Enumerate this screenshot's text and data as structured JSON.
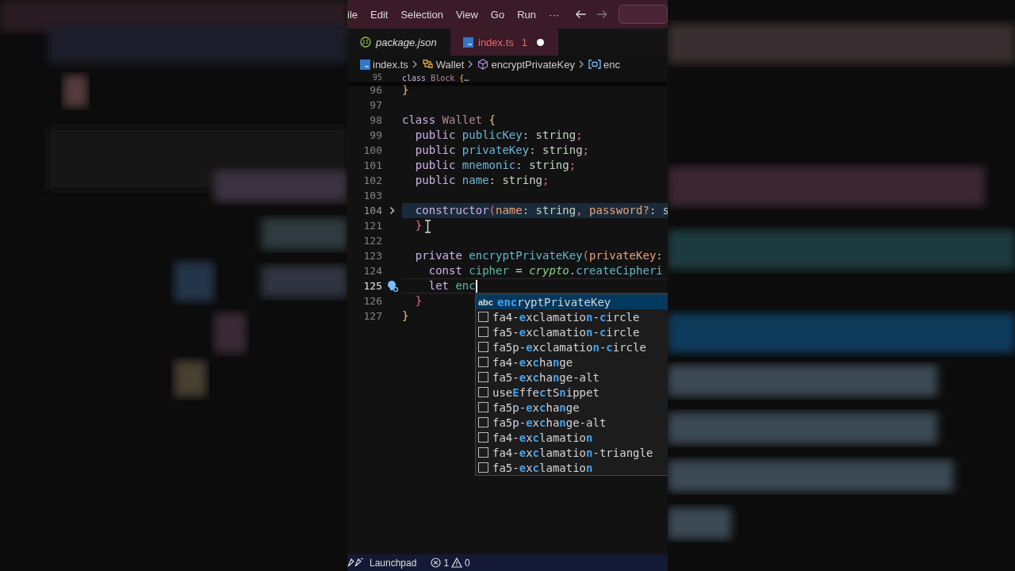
{
  "menu": [
    "ile",
    "Edit",
    "Selection",
    "View",
    "Go",
    "Run",
    "···"
  ],
  "tabs": [
    {
      "label": "package.json",
      "kind": "json",
      "selected": false,
      "italic": true
    },
    {
      "label": "index.ts",
      "kind": "ts",
      "selected": true,
      "italic": false,
      "problems": "1",
      "modified": true
    }
  ],
  "breadcrumb": [
    {
      "label": "index.ts",
      "kind": "file"
    },
    {
      "label": "Wallet",
      "kind": "class"
    },
    {
      "label": "encryptPrivateKey",
      "kind": "method"
    },
    {
      "label": "enc",
      "kind": "variable"
    }
  ],
  "sticky_line": {
    "number": "95",
    "tokens": [
      {
        "text": "class ",
        "kind": "kw"
      },
      {
        "text": "Block ",
        "kind": "cls"
      },
      {
        "text": "{",
        "kind": "brace"
      },
      {
        "text": "…",
        "kind": "plain"
      }
    ]
  },
  "code_lines": [
    {
      "number": "96",
      "folded": false,
      "current": false,
      "tokens": [
        {
          "text": "}",
          "kind": "brace"
        }
      ]
    },
    {
      "number": "97",
      "folded": false,
      "current": false
    },
    {
      "number": "98",
      "folded": false,
      "current": false,
      "tokens": [
        {
          "text": "class ",
          "kind": "kw"
        },
        {
          "text": "Wallet ",
          "kind": "cls"
        },
        {
          "text": "{",
          "kind": "brace"
        }
      ]
    },
    {
      "number": "99",
      "folded": false,
      "current": false,
      "tokens": [
        {
          "text": "  public ",
          "kind": "kw"
        },
        {
          "text": "publicKey",
          "kind": "prop"
        },
        {
          "text": ": ",
          "kind": "plain"
        },
        {
          "text": "string",
          "kind": "type"
        },
        {
          "text": ";",
          "kind": "punct"
        }
      ]
    },
    {
      "number": "100",
      "folded": false,
      "current": false,
      "tokens": [
        {
          "text": "  public ",
          "kind": "kw"
        },
        {
          "text": "privateKey",
          "kind": "prop"
        },
        {
          "text": ": ",
          "kind": "plain"
        },
        {
          "text": "string",
          "kind": "type"
        },
        {
          "text": ";",
          "kind": "punct"
        }
      ]
    },
    {
      "number": "101",
      "folded": false,
      "current": false,
      "tokens": [
        {
          "text": "  public ",
          "kind": "kw"
        },
        {
          "text": "mnemonic",
          "kind": "prop"
        },
        {
          "text": ": ",
          "kind": "plain"
        },
        {
          "text": "string",
          "kind": "type"
        },
        {
          "text": ";",
          "kind": "punct"
        }
      ]
    },
    {
      "number": "102",
      "folded": false,
      "current": false,
      "tokens": [
        {
          "text": "  public ",
          "kind": "kw"
        },
        {
          "text": "name",
          "kind": "prop"
        },
        {
          "text": ": ",
          "kind": "plain"
        },
        {
          "text": "string",
          "kind": "type"
        },
        {
          "text": ";",
          "kind": "punct"
        }
      ]
    },
    {
      "number": "103",
      "folded": false,
      "current": false
    },
    {
      "number": "104",
      "folded": true,
      "current": false,
      "tokens": [
        {
          "text": "  constructor",
          "kind": "kw"
        },
        {
          "text": "(",
          "kind": "punct"
        },
        {
          "text": "name",
          "kind": "param"
        },
        {
          "text": ": ",
          "kind": "plain"
        },
        {
          "text": "string",
          "kind": "type"
        },
        {
          "text": ", ",
          "kind": "punct"
        },
        {
          "text": "password?",
          "kind": "param"
        },
        {
          "text": ": ",
          "kind": "plain"
        },
        {
          "text": "s",
          "kind": "type"
        }
      ]
    },
    {
      "number": "121",
      "folded": false,
      "current": false,
      "tokens": [
        {
          "text": "  }",
          "kind": "punct"
        }
      ]
    },
    {
      "number": "122",
      "folded": false,
      "current": false
    },
    {
      "number": "123",
      "folded": false,
      "current": false,
      "tokens": [
        {
          "text": "  private ",
          "kind": "kw"
        },
        {
          "text": "encryptPrivateKey",
          "kind": "fn"
        },
        {
          "text": "(",
          "kind": "punct"
        },
        {
          "text": "privateKey",
          "kind": "param"
        },
        {
          "text": ":",
          "kind": "plain"
        }
      ]
    },
    {
      "number": "124",
      "folded": false,
      "current": false,
      "tokens": [
        {
          "text": "    const ",
          "kind": "kw"
        },
        {
          "text": "cipher",
          "kind": "var"
        },
        {
          "text": " = ",
          "kind": "plain"
        },
        {
          "text": "crypto",
          "kind": "obj"
        },
        {
          "text": ".",
          "kind": "plain"
        },
        {
          "text": "createCipheri",
          "kind": "fn"
        }
      ]
    },
    {
      "number": "125",
      "folded": false,
      "current": true,
      "tokens": [
        {
          "text": "    let ",
          "kind": "kw"
        },
        {
          "text": "enc",
          "kind": "var"
        }
      ]
    },
    {
      "number": "126",
      "folded": false,
      "current": false,
      "tokens": [
        {
          "text": "  }",
          "kind": "punct"
        }
      ]
    },
    {
      "number": "127",
      "folded": false,
      "current": false,
      "tokens": [
        {
          "text": "}",
          "kind": "brace"
        }
      ]
    }
  ],
  "suggestions": [
    {
      "kind": "word",
      "icon_text": "abc",
      "selected": true,
      "parts": [
        {
          "text": "enc",
          "match": true
        },
        {
          "text": "ryptPrivateKey",
          "match": false
        }
      ]
    },
    {
      "kind": "snippet",
      "selected": false,
      "parts": [
        {
          "text": "fa4-",
          "match": false
        },
        {
          "text": "e",
          "match": true
        },
        {
          "text": "xclamatio",
          "match": false
        },
        {
          "text": "n",
          "match": true
        },
        {
          "text": "-",
          "match": false
        },
        {
          "text": "c",
          "match": true
        },
        {
          "text": "ircle",
          "match": false
        }
      ]
    },
    {
      "kind": "snippet",
      "selected": false,
      "parts": [
        {
          "text": "fa5-",
          "match": false
        },
        {
          "text": "e",
          "match": true
        },
        {
          "text": "xclamatio",
          "match": false
        },
        {
          "text": "n",
          "match": true
        },
        {
          "text": "-",
          "match": false
        },
        {
          "text": "c",
          "match": true
        },
        {
          "text": "ircle",
          "match": false
        }
      ]
    },
    {
      "kind": "snippet",
      "selected": false,
      "parts": [
        {
          "text": "fa5p-",
          "match": false
        },
        {
          "text": "e",
          "match": true
        },
        {
          "text": "xclamatio",
          "match": false
        },
        {
          "text": "n",
          "match": true
        },
        {
          "text": "-",
          "match": false
        },
        {
          "text": "c",
          "match": true
        },
        {
          "text": "ircle",
          "match": false
        }
      ]
    },
    {
      "kind": "snippet",
      "selected": false,
      "parts": [
        {
          "text": "fa4-",
          "match": false
        },
        {
          "text": "e",
          "match": true
        },
        {
          "text": "x",
          "match": false
        },
        {
          "text": "c",
          "match": true
        },
        {
          "text": "ha",
          "match": false
        },
        {
          "text": "n",
          "match": true
        },
        {
          "text": "ge",
          "match": false
        }
      ]
    },
    {
      "kind": "snippet",
      "selected": false,
      "parts": [
        {
          "text": "fa5-",
          "match": false
        },
        {
          "text": "e",
          "match": true
        },
        {
          "text": "x",
          "match": false
        },
        {
          "text": "c",
          "match": true
        },
        {
          "text": "ha",
          "match": false
        },
        {
          "text": "n",
          "match": true
        },
        {
          "text": "ge-alt",
          "match": false
        }
      ]
    },
    {
      "kind": "snippet",
      "selected": false,
      "parts": [
        {
          "text": "use",
          "match": false
        },
        {
          "text": "E",
          "match": true
        },
        {
          "text": "ffe",
          "match": false
        },
        {
          "text": "c",
          "match": true
        },
        {
          "text": "tS",
          "match": false
        },
        {
          "text": "n",
          "match": true
        },
        {
          "text": "ippet",
          "match": false
        }
      ]
    },
    {
      "kind": "snippet",
      "selected": false,
      "parts": [
        {
          "text": "fa5p-",
          "match": false
        },
        {
          "text": "e",
          "match": true
        },
        {
          "text": "x",
          "match": false
        },
        {
          "text": "c",
          "match": true
        },
        {
          "text": "ha",
          "match": false
        },
        {
          "text": "n",
          "match": true
        },
        {
          "text": "ge",
          "match": false
        }
      ]
    },
    {
      "kind": "snippet",
      "selected": false,
      "parts": [
        {
          "text": "fa5p-",
          "match": false
        },
        {
          "text": "e",
          "match": true
        },
        {
          "text": "x",
          "match": false
        },
        {
          "text": "c",
          "match": true
        },
        {
          "text": "ha",
          "match": false
        },
        {
          "text": "n",
          "match": true
        },
        {
          "text": "ge-alt",
          "match": false
        }
      ]
    },
    {
      "kind": "snippet",
      "selected": false,
      "parts": [
        {
          "text": "fa4-",
          "match": false
        },
        {
          "text": "e",
          "match": true
        },
        {
          "text": "x",
          "match": false
        },
        {
          "text": "c",
          "match": true
        },
        {
          "text": "lamatio",
          "match": false
        },
        {
          "text": "n",
          "match": true
        }
      ]
    },
    {
      "kind": "snippet",
      "selected": false,
      "parts": [
        {
          "text": "fa4-",
          "match": false
        },
        {
          "text": "e",
          "match": true
        },
        {
          "text": "x",
          "match": false
        },
        {
          "text": "c",
          "match": true
        },
        {
          "text": "lamatio",
          "match": false
        },
        {
          "text": "n",
          "match": true
        },
        {
          "text": "-triangle",
          "match": false
        }
      ]
    },
    {
      "kind": "snippet",
      "selected": false,
      "parts": [
        {
          "text": "fa5-",
          "match": false
        },
        {
          "text": "e",
          "match": true
        },
        {
          "text": "x",
          "match": false
        },
        {
          "text": "c",
          "match": true
        },
        {
          "text": "lamatio",
          "match": false
        },
        {
          "text": "n",
          "match": true
        }
      ]
    }
  ],
  "status_bar": {
    "launchpad": "Launchpad",
    "errors": "1",
    "warnings": "0"
  }
}
